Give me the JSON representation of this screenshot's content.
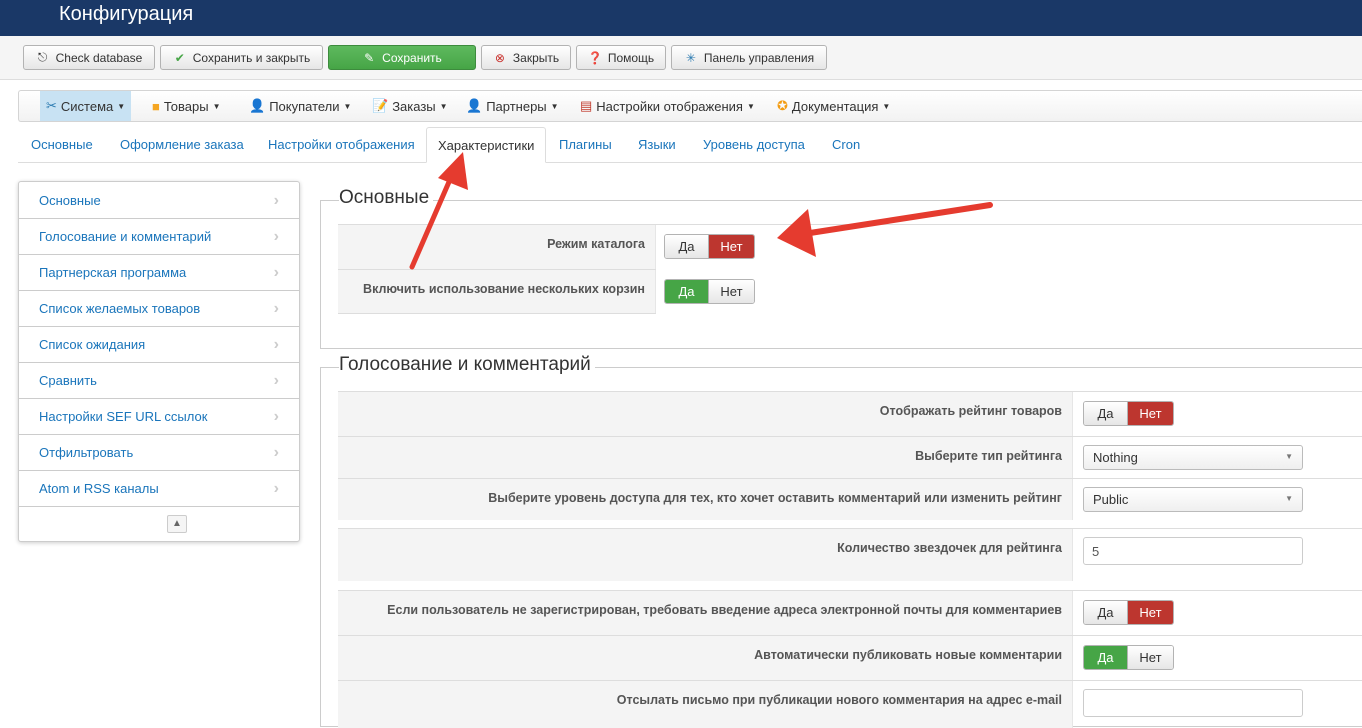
{
  "title": "Конфигурация",
  "toolbar": {
    "check": "Check database",
    "save_close": "Сохранить и закрыть",
    "save": "Сохранить",
    "close": "Закрыть",
    "help": "Помощь",
    "panel": "Панель управления"
  },
  "menu": [
    "Система",
    "Товары",
    "Покупатели",
    "Заказы",
    "Партнеры",
    "Настройки отображения",
    "Документация"
  ],
  "tabs": [
    "Основные",
    "Оформление заказа",
    "Настройки отображения",
    "Характеристики",
    "Плагины",
    "Языки",
    "Уровень доступа",
    "Cron"
  ],
  "sidebar": [
    "Основные",
    "Голосование и комментарий",
    "Партнерская программа",
    "Список желаемых товаров",
    "Список ожидания",
    "Сравнить",
    "Настройки SEF URL ссылок",
    "Отфильтровать",
    "Atom и RSS каналы"
  ],
  "yes": "Да",
  "no": "Нет",
  "section1": {
    "title": "Основные",
    "rows": [
      "Режим каталога",
      "Включить использование нескольких корзин"
    ]
  },
  "section2": {
    "title": "Голосование и комментарий",
    "rows": [
      "Отображать рейтинг товаров",
      "Выберите тип рейтинга",
      "Выберите уровень доступа для тех, кто хочет оставить комментарий или изменить рейтинг",
      "Количество звездочек для рейтинга",
      "Если пользователь не зарегистрирован, требовать введение адреса электронной почты для комментариев",
      "Автоматически публиковать новые комментарии",
      "Отсылать письмо при публикации нового комментария на адрес e-mail"
    ],
    "rating_type": "Nothing",
    "access_level": "Public",
    "stars": "5",
    "email": ""
  }
}
